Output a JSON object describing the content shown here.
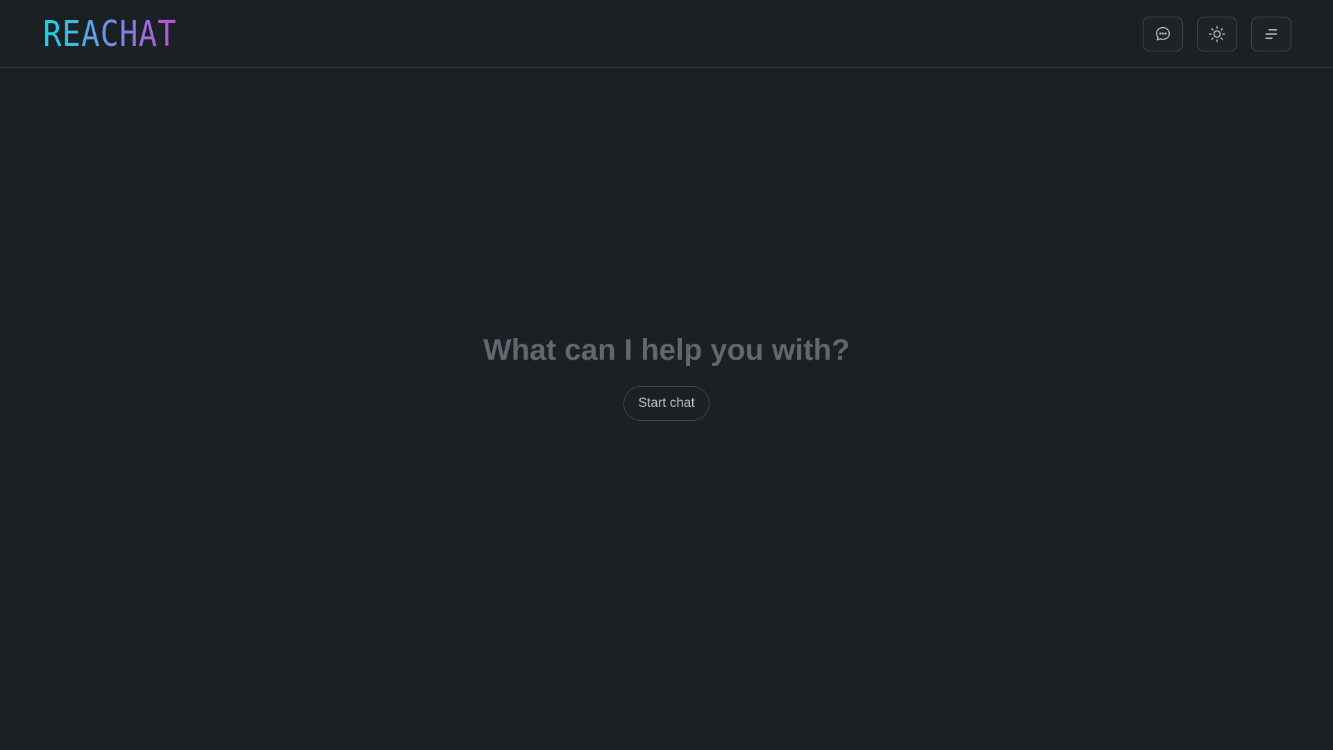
{
  "header": {
    "logo_text": "REACHAT",
    "buttons": [
      {
        "icon": "chat-bubble-icon"
      },
      {
        "icon": "sun-icon"
      },
      {
        "icon": "menu-icon"
      }
    ]
  },
  "main": {
    "headline": "What can I help you with?",
    "start_label": "Start chat"
  },
  "colors": {
    "background": "#1b2024",
    "border": "#464c52",
    "headline": "#616870",
    "logo_gradient_start": "#19d7e0",
    "logo_gradient_end": "#c04fd8"
  }
}
